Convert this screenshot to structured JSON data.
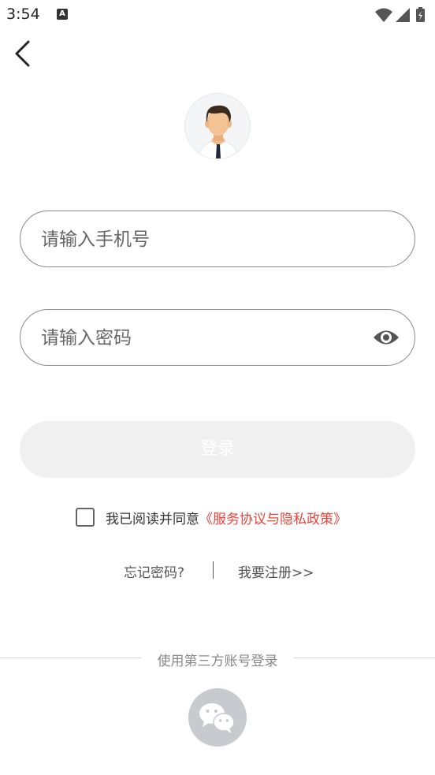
{
  "status_bar": {
    "time": "3:54",
    "notification_badge": "A"
  },
  "login": {
    "phone_placeholder": "请输入手机号",
    "password_placeholder": "请输入密码",
    "login_label": "登录",
    "agree_text": "我已阅读并同意",
    "agreement_link": "《服务协议与隐私政策》",
    "forgot_label": "忘记密码?",
    "register_label": "我要注册>>",
    "third_party_label": "使用第三方账号登录"
  },
  "colors": {
    "accent_red": "#e8453c",
    "login_disabled_bg": "#f0f0f0",
    "wechat_bg": "#c8cad0"
  },
  "icons": [
    "back-arrow-icon",
    "avatar-icon",
    "eye-icon",
    "wechat-icon",
    "wifi-icon",
    "signal-icon",
    "battery-icon"
  ]
}
